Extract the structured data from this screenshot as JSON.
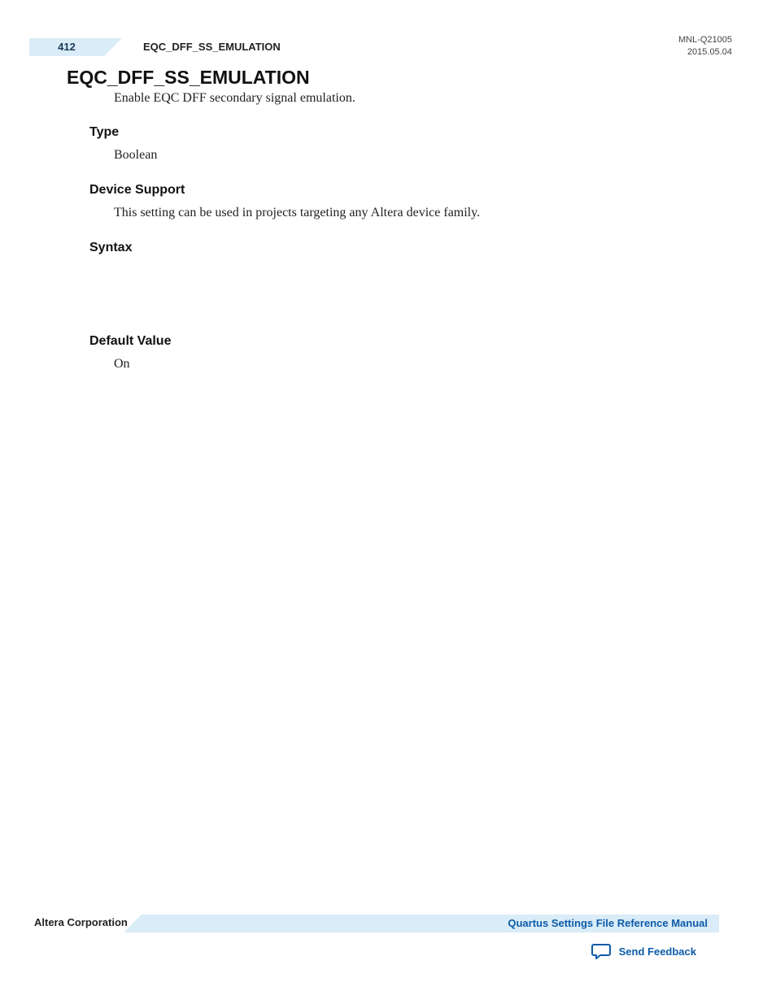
{
  "header": {
    "page_number": "412",
    "running_title": "EQC_DFF_SS_EMULATION",
    "doc_id": "MNL-Q21005",
    "doc_date": "2015.05.04"
  },
  "main": {
    "title": "EQC_DFF_SS_EMULATION",
    "intro": "Enable EQC DFF secondary signal emulation.",
    "sections": {
      "type": {
        "heading": "Type",
        "body": "Boolean"
      },
      "device_support": {
        "heading": "Device Support",
        "body": "This setting can be used in projects targeting any Altera device family."
      },
      "syntax": {
        "heading": "Syntax",
        "body": ""
      },
      "default_value": {
        "heading": "Default Value",
        "body": "On"
      }
    }
  },
  "footer": {
    "company": "Altera Corporation",
    "manual_link": "Quartus Settings File Reference Manual",
    "feedback_label": "Send Feedback"
  }
}
